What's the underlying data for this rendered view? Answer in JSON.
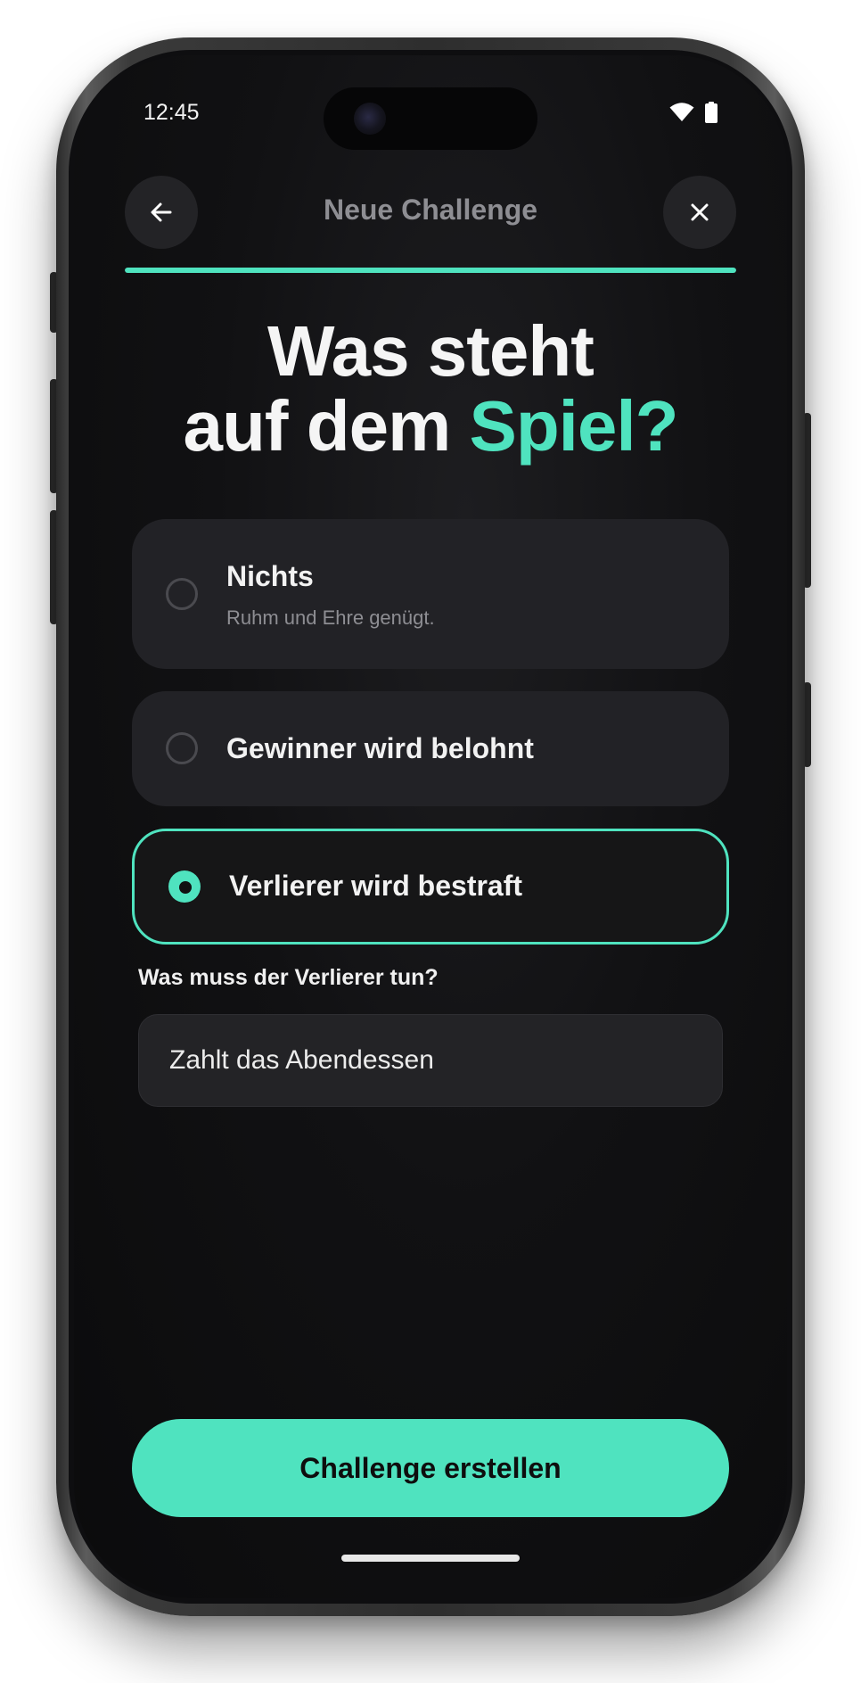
{
  "status_bar": {
    "time": "12:45",
    "wifi_icon": "wifi-icon",
    "battery_icon": "battery-icon"
  },
  "header": {
    "back_icon": "arrow-left-icon",
    "title": "Neue Challenge",
    "close_icon": "close-icon",
    "progress": 1.0
  },
  "headline": {
    "line1": "Was steht",
    "line2_prefix": "auf dem ",
    "line2_accent": "Spiel?"
  },
  "options": [
    {
      "title": "Nichts",
      "subtitle": "Ruhm und Ehre genügt.",
      "selected": false
    },
    {
      "title": "Gewinner wird belohnt",
      "selected": false
    },
    {
      "title": "Verlierer wird bestraft",
      "selected": true
    }
  ],
  "penalty_field": {
    "label": "Was muss der Verlierer tun?",
    "value": "Zahlt das Abendessen"
  },
  "cta": {
    "label": "Challenge erstellen"
  },
  "colors": {
    "accent": "#4fe3bf",
    "background": "#0e0e10",
    "card": "#222226",
    "muted_text": "#8e8e93"
  }
}
